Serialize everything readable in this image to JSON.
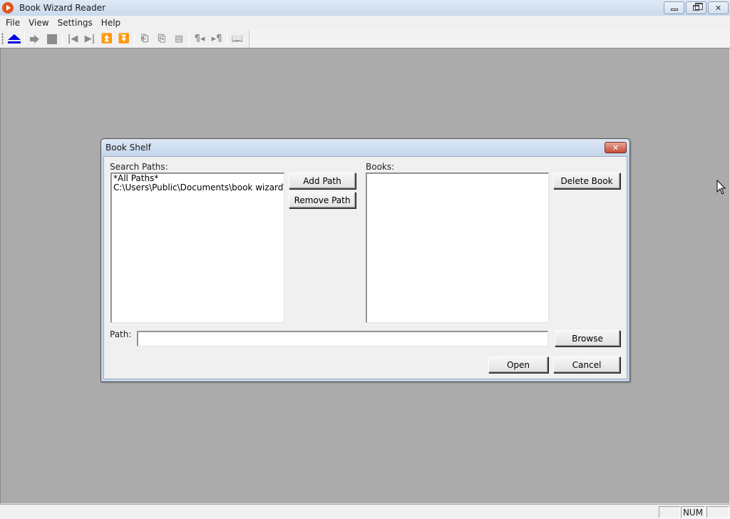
{
  "window": {
    "title": "Book Wizard Reader",
    "controls": [
      "minimize",
      "restore",
      "close"
    ]
  },
  "menu": {
    "items": [
      {
        "label": "File"
      },
      {
        "label": "View"
      },
      {
        "label": "Settings"
      },
      {
        "label": "Help"
      }
    ]
  },
  "toolbar": {
    "buttons": [
      {
        "name": "eject-icon"
      },
      {
        "name": "play-icon"
      },
      {
        "name": "stop-icon"
      },
      {
        "name": "first-page-icon"
      },
      {
        "name": "last-page-icon"
      },
      {
        "name": "page-up-icon"
      },
      {
        "name": "page-down-icon"
      },
      {
        "name": "previous-bookmark-icon"
      },
      {
        "name": "next-bookmark-icon"
      },
      {
        "name": "document-icon"
      },
      {
        "name": "previous-paragraph-icon"
      },
      {
        "name": "next-paragraph-icon"
      },
      {
        "name": "book-help-icon"
      }
    ]
  },
  "dialog": {
    "title": "Book Shelf",
    "search_paths_label": "Search Paths:",
    "search_paths": [
      "*All Paths*",
      "C:\\Users\\Public\\Documents\\book wizard\\"
    ],
    "add_path_label": "Add Path",
    "remove_path_label": "Remove Path",
    "books_label": "Books:",
    "books": [],
    "delete_book_label": "Delete Book",
    "path_label": "Path:",
    "path_value": "",
    "browse_label": "Browse",
    "open_label": "Open",
    "cancel_label": "Cancel"
  },
  "statusbar": {
    "panes": [
      "",
      "NUM",
      ""
    ]
  }
}
